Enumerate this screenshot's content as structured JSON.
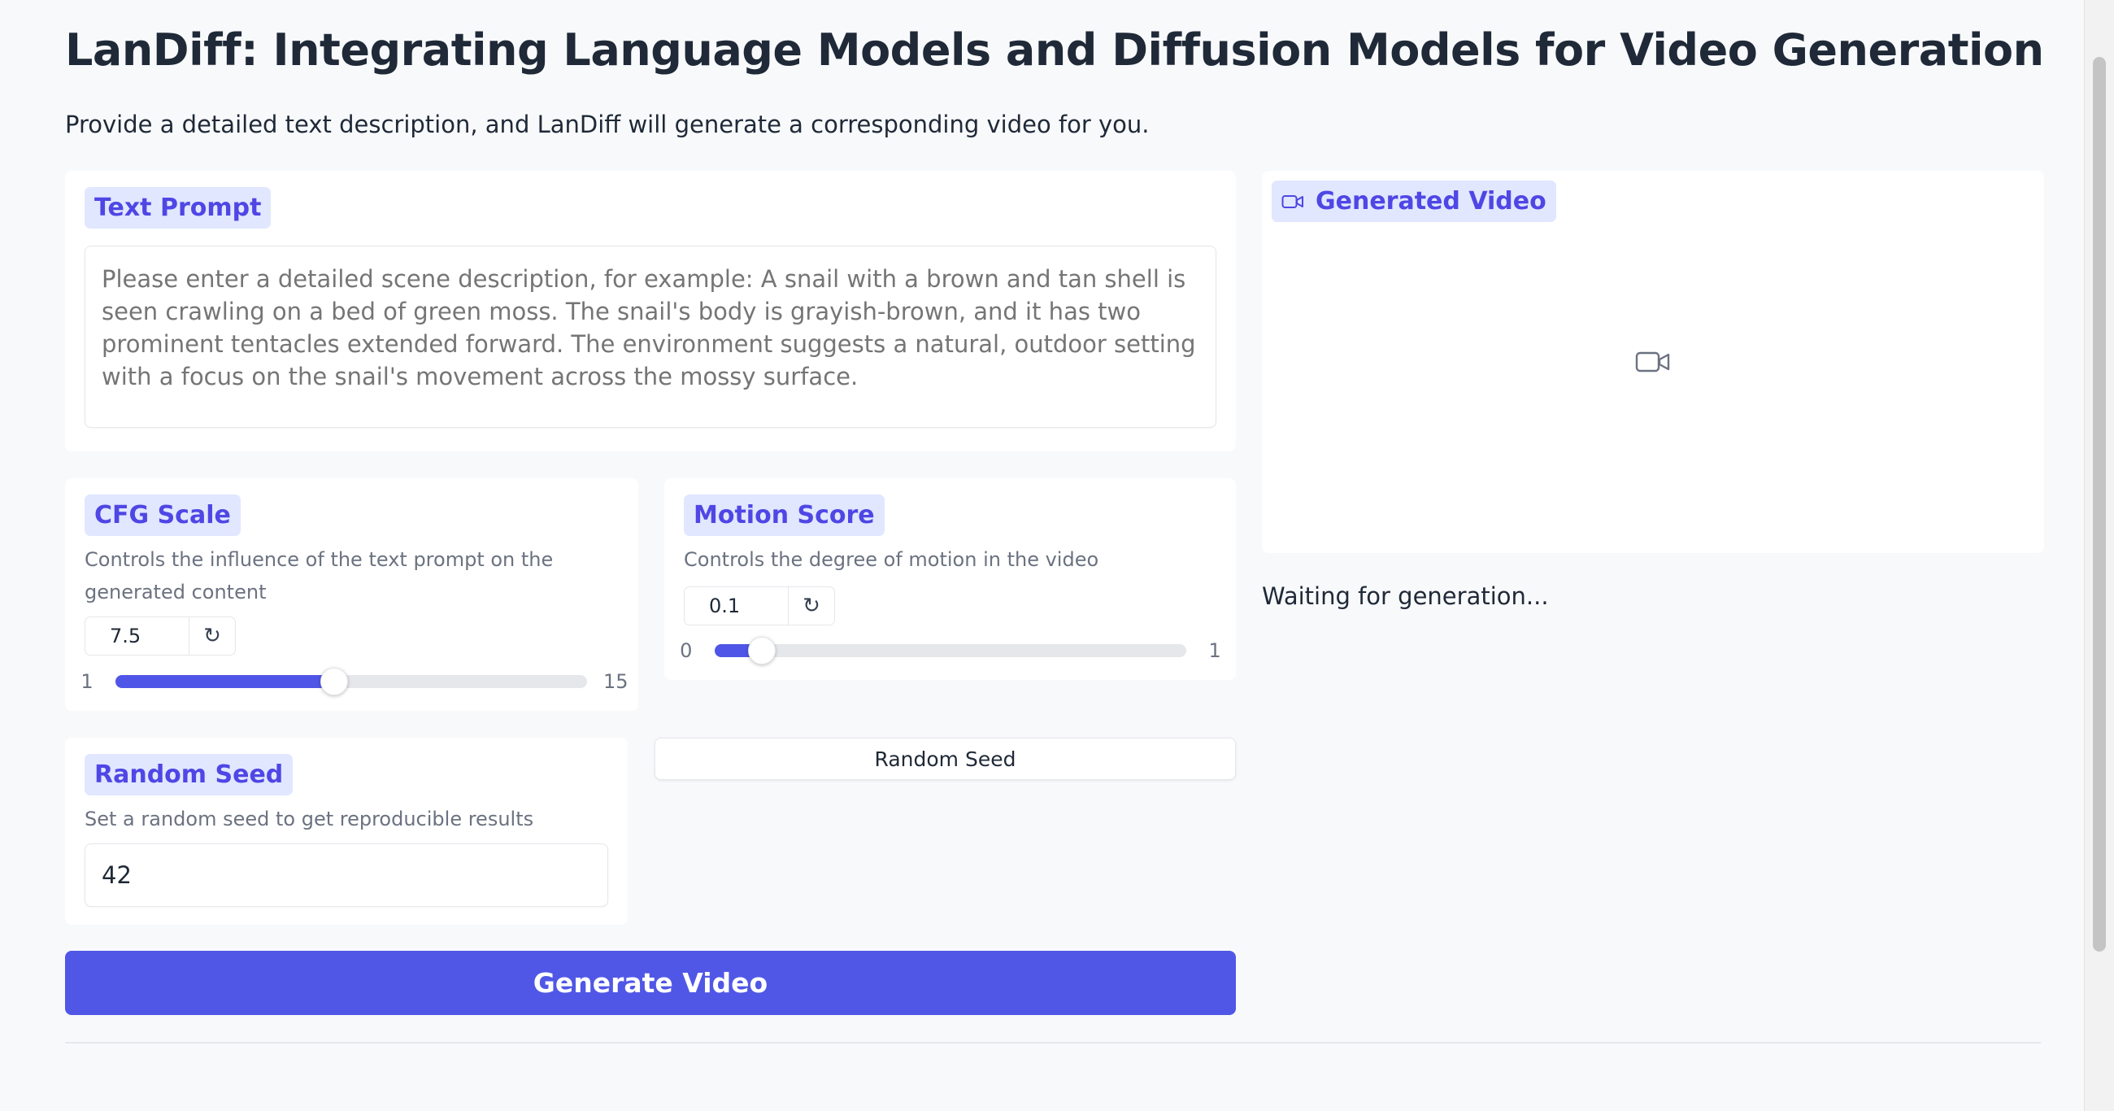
{
  "header": {
    "title": "LanDiff: Integrating Language Models and Diffusion Models for Video Generation",
    "subtitle": "Provide a detailed text description, and LanDiff will generate a corresponding video for you."
  },
  "prompt": {
    "label": "Text Prompt",
    "placeholder": "Please enter a detailed scene description, for example: A snail with a brown and tan shell is seen crawling on a bed of green moss. The snail's body is grayish-brown, and it has two prominent tentacles extended forward. The environment suggests a natural, outdoor setting with a focus on the snail's movement across the mossy surface.",
    "value": ""
  },
  "cfg": {
    "label": "CFG Scale",
    "info": "Controls the influence of the text prompt on the generated content",
    "value": "7.5",
    "min": "1",
    "max": "15",
    "current": 7.5,
    "min_value": 1,
    "max_value": 15
  },
  "motion": {
    "label": "Motion Score",
    "info": "Controls the degree of motion in the video",
    "value": "0.1",
    "min": "0",
    "max": "1",
    "current": 0.1,
    "min_value": 0,
    "max_value": 1
  },
  "seed": {
    "label": "Random Seed",
    "info": "Set a random seed to get reproducible results",
    "value": "42",
    "button_label": "Random Seed"
  },
  "generate": {
    "label": "Generate Video"
  },
  "output": {
    "label": "Generated Video",
    "status": "Waiting for generation..."
  },
  "icons": {
    "video_label_icon": "video-camera-icon",
    "placeholder_icon": "video-camera-icon",
    "reset_icon": "reset-arrow-icon"
  },
  "colors": {
    "accent": "#5057e6",
    "chip_bg": "#e0e7ff",
    "chip_text": "#4f46e5",
    "page_bg": "#f8f9fb"
  }
}
